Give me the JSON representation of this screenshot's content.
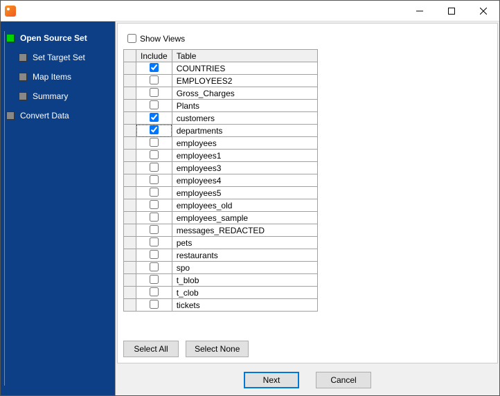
{
  "titlebar": {
    "min": "–",
    "max": "▢",
    "close": "✕"
  },
  "sidebar": {
    "steps": [
      {
        "label": "Open Source Set",
        "active": true,
        "bold": true,
        "sub": false
      },
      {
        "label": "Set Target Set",
        "active": false,
        "bold": false,
        "sub": true
      },
      {
        "label": "Map Items",
        "active": false,
        "bold": false,
        "sub": true
      },
      {
        "label": "Summary",
        "active": false,
        "bold": false,
        "sub": true
      },
      {
        "label": "Convert Data",
        "active": false,
        "bold": false,
        "sub": false
      }
    ]
  },
  "content": {
    "show_views_label": "Show Views",
    "show_views_checked": false,
    "columns": {
      "include": "Include",
      "table": "Table"
    },
    "rows": [
      {
        "name": "COUNTRIES",
        "checked": true,
        "focus": false
      },
      {
        "name": "EMPLOYEES2",
        "checked": false,
        "focus": false
      },
      {
        "name": "Gross_Charges",
        "checked": false,
        "focus": false
      },
      {
        "name": "Plants",
        "checked": false,
        "focus": false
      },
      {
        "name": "customers",
        "checked": true,
        "focus": false
      },
      {
        "name": "departments",
        "checked": true,
        "focus": true
      },
      {
        "name": "employees",
        "checked": false,
        "focus": false
      },
      {
        "name": "employees1",
        "checked": false,
        "focus": false
      },
      {
        "name": "employees3",
        "checked": false,
        "focus": false
      },
      {
        "name": "employees4",
        "checked": false,
        "focus": false
      },
      {
        "name": "employees5",
        "checked": false,
        "focus": false
      },
      {
        "name": "employees_old",
        "checked": false,
        "focus": false
      },
      {
        "name": "employees_sample",
        "checked": false,
        "focus": false
      },
      {
        "name": "messages_REDACTED",
        "checked": false,
        "focus": false
      },
      {
        "name": "pets",
        "checked": false,
        "focus": false
      },
      {
        "name": "restaurants",
        "checked": false,
        "focus": false
      },
      {
        "name": "spo",
        "checked": false,
        "focus": false
      },
      {
        "name": "t_blob",
        "checked": false,
        "focus": false
      },
      {
        "name": "t_clob",
        "checked": false,
        "focus": false
      },
      {
        "name": "tickets",
        "checked": false,
        "focus": false
      }
    ],
    "select_all": "Select All",
    "select_none": "Select None"
  },
  "footer": {
    "next": "Next",
    "cancel": "Cancel"
  }
}
